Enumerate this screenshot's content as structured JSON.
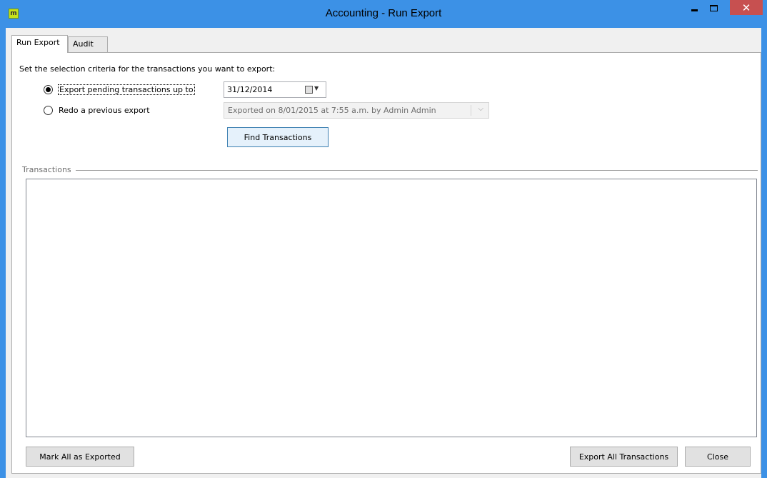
{
  "window": {
    "title": "Accounting - Run Export",
    "app_icon_letter": "m",
    "close_glyph": "✕"
  },
  "tabs": [
    {
      "label": "Run Export",
      "active": true
    },
    {
      "label": "Audit",
      "active": false
    }
  ],
  "criteria": {
    "prompt": "Set the selection criteria for the transactions you want to export:",
    "option_pending_label": "Export pending transactions up to",
    "option_redo_label": "Redo a previous export",
    "selected_option": "pending",
    "date_value": "31/12/2014",
    "previous_export_value": "Exported on 8/01/2015 at 7:55 a.m. by Admin Admin",
    "find_button": "Find Transactions"
  },
  "transactions": {
    "group_label": "Transactions",
    "items": []
  },
  "footer": {
    "mark_all_button": "Mark All as Exported",
    "export_all_button": "Export All Transactions",
    "close_button": "Close"
  },
  "colors": {
    "titlebar": "#3c91e6",
    "close_button": "#c75050",
    "app_icon": "#c6e21b"
  }
}
